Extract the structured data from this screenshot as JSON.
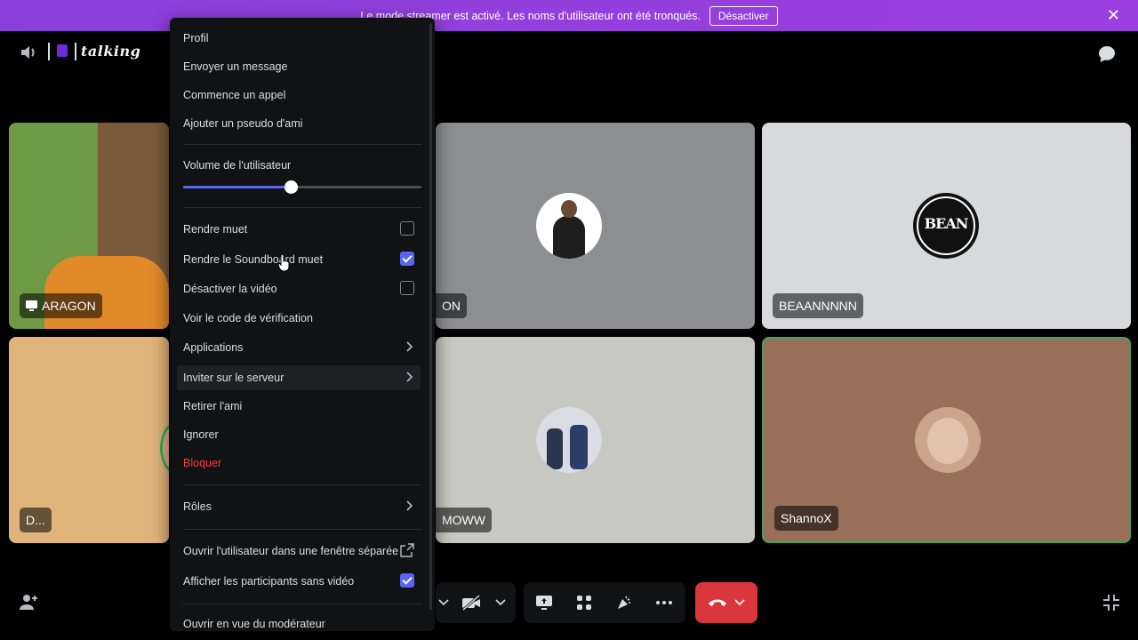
{
  "banner": {
    "text": "Le mode streamer est activé. Les noms d'utilisateur ont été tronqués.",
    "button_label": "Désactiver",
    "close": "✕"
  },
  "header": {
    "channel_name": "talking"
  },
  "tiles": [
    {
      "label": "ARAGON",
      "bg": "#6e9a45"
    },
    {
      "label": "ON",
      "bg": "#8d8e92"
    },
    {
      "label": "BEAANNNNN",
      "bg": "#d8d9dc"
    },
    {
      "label": "D...",
      "bg": "#e0b37a"
    },
    {
      "label": "MOWW",
      "bg": "#c8c8c2"
    },
    {
      "label": "ShannoX",
      "bg": "#9a6f5a"
    }
  ],
  "avatars": {
    "beann_text": "BEAN"
  },
  "menu": {
    "items": {
      "profile": "Profil",
      "send_message": "Envoyer un message",
      "start_call": "Commence un appel",
      "add_nickname": "Ajouter un pseudo d'ami",
      "user_volume": "Volume de l'utilisateur",
      "mute": "Rendre muet",
      "mute_soundboard": "Rendre le Soundboard muet",
      "disable_video": "Désactiver la vidéo",
      "verification_code": "Voir le code de vérification",
      "applications": "Applications",
      "invite_server": "Inviter sur le serveur",
      "remove_friend": "Retirer l'ami",
      "ignore": "Ignorer",
      "block": "Bloquer",
      "roles": "Rôles",
      "open_separate_window": "Ouvrir l'utilisateur dans une fenêtre séparée",
      "show_no_video": "Afficher les participants sans vidéo",
      "moderator_view": "Ouvrir en vue du modérateur"
    },
    "volume_level": 0.45,
    "checkboxes": {
      "mute": false,
      "mute_soundboard": true,
      "disable_video": false,
      "show_no_video": true
    }
  },
  "colors": {
    "banner": "#9b3fe0",
    "accent": "#5865f2",
    "danger": "#da373c",
    "speaking_border": "#3ba55d"
  },
  "icons": [
    "speaker-icon",
    "chat-icon",
    "chevron-right-icon",
    "external-window-icon",
    "add-user-icon",
    "screen-share-icon",
    "activities-icon",
    "soundboard-icon",
    "more-icon",
    "hangup-icon",
    "camera-off-icon",
    "exit-fullscreen-icon"
  ]
}
